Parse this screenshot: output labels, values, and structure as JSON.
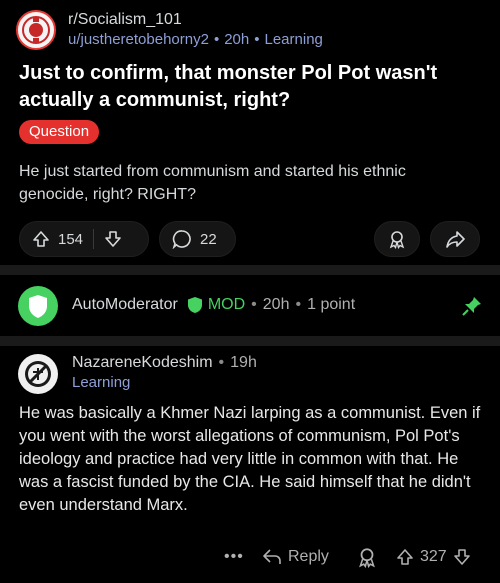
{
  "post": {
    "subreddit": "r/Socialism_101",
    "author": "u/justheretobehorny2",
    "age": "20h",
    "flair": "Learning",
    "title": "Just to confirm, that monster Pol Pot wasn't actually a communist, right?",
    "tag": "Question",
    "body": "He just started from communism and started his ethnic genocide, right? RIGHT?",
    "upvotes": "154",
    "comments": "22",
    "icons": [
      "upvote-icon",
      "downvote-icon",
      "comment-icon",
      "award-icon",
      "share-icon"
    ]
  },
  "automod": {
    "name": "AutoModerator",
    "badge": "MOD",
    "age": "20h",
    "points": "1 point",
    "icons": [
      "shield-icon",
      "pin-icon"
    ]
  },
  "comment": {
    "author": "NazareneKodeshim",
    "age": "19h",
    "flair": "Learning",
    "body": "He was basically a Khmer Nazi larping as a communist. Even if you went with the worst allegations of communism, Pol Pot's ideology and practice had very little in common with that. He was a fascist funded by the CIA. He said himself that he didn't even understand Marx.",
    "more": "•••",
    "reply": "Reply",
    "votes": "327",
    "icons": [
      "more-icon",
      "reply-icon",
      "award-icon",
      "upvote-icon",
      "downvote-icon"
    ]
  },
  "colors": {
    "accent_flair": "#e5312d",
    "mod_green": "#46d160",
    "meta_blue": "#8e9fd6"
  }
}
